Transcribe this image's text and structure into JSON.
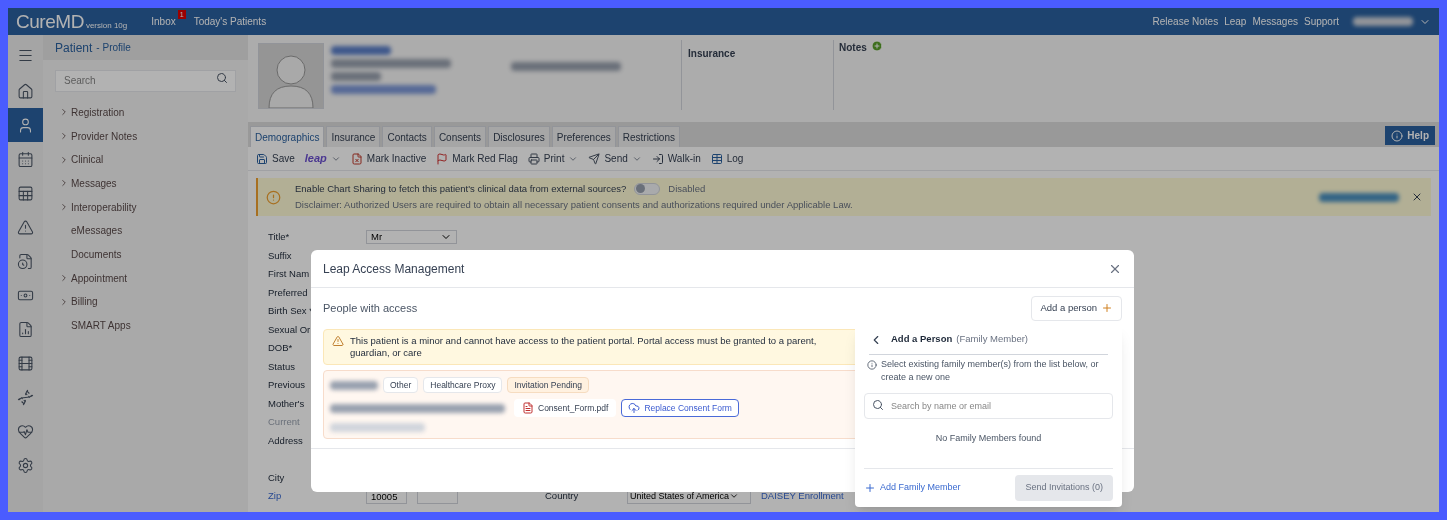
{
  "header": {
    "logo": "CureMD",
    "version": "version 10g",
    "links": [
      {
        "label": "Inbox",
        "badge": "1"
      },
      {
        "label": "Today's Patients"
      }
    ],
    "right_links": [
      "Release Notes",
      "Leap",
      "Messages",
      "Support"
    ]
  },
  "rail": [
    {
      "selected": false
    },
    {
      "selected": false
    },
    {
      "selected": true
    },
    {
      "selected": false
    },
    {
      "selected": false
    },
    {
      "selected": false
    },
    {
      "selected": false
    },
    {
      "selected": false
    },
    {
      "selected": false
    },
    {
      "selected": false
    },
    {
      "selected": false
    },
    {
      "selected": false
    },
    {
      "selected": false
    }
  ],
  "nav": {
    "title": "Patient",
    "subtitle": "- Profile",
    "search_placeholder": "Search",
    "items": [
      {
        "label": "Registration",
        "expandable": true
      },
      {
        "label": "Provider Notes",
        "expandable": true
      },
      {
        "label": "Clinical",
        "expandable": true
      },
      {
        "label": "Messages",
        "expandable": true
      },
      {
        "label": "Interoperability",
        "expandable": true
      },
      {
        "label": "eMessages",
        "expandable": false
      },
      {
        "label": "Documents",
        "expandable": false
      },
      {
        "label": "Appointment",
        "expandable": true
      },
      {
        "label": "Billing",
        "expandable": true
      },
      {
        "label": "SMART Apps",
        "expandable": false
      }
    ]
  },
  "patient": {
    "insurance_label": "Insurance",
    "notes_label": "Notes"
  },
  "tabs": [
    {
      "label": "Demographics",
      "selected": true
    },
    {
      "label": "Insurance",
      "selected": false
    },
    {
      "label": "Contacts",
      "selected": false
    },
    {
      "label": "Consents",
      "selected": false
    },
    {
      "label": "Disclosures",
      "selected": false
    },
    {
      "label": "Preferences",
      "selected": false
    },
    {
      "label": "Restrictions",
      "selected": false
    }
  ],
  "help": "Help",
  "toolbar": [
    {
      "kind": "action",
      "label": "Save",
      "dropdown": false
    },
    {
      "kind": "logo",
      "label": "leap",
      "dropdown": true
    },
    {
      "kind": "action",
      "label": "Mark Inactive",
      "dropdown": false
    },
    {
      "kind": "action",
      "label": "Mark Red Flag",
      "dropdown": false
    },
    {
      "kind": "action",
      "label": "Print",
      "dropdown": true
    },
    {
      "kind": "action",
      "label": "Send",
      "dropdown": true
    },
    {
      "kind": "action",
      "label": "Walk-in",
      "dropdown": false
    },
    {
      "kind": "action",
      "label": "Log",
      "dropdown": false
    }
  ],
  "chart_sharing": {
    "message": "Enable Chart Sharing to fetch this patient's clinical data from external sources?",
    "on": false,
    "toggle_label": "Disabled",
    "disclaimer": "Disclaimer: Authorized Users are required to obtain all necessary patient consents and authorizations required under Applicable Law."
  },
  "form": [
    {
      "label": "Title*",
      "kind": "select",
      "value": "Mr"
    },
    {
      "label": "Suffix",
      "kind": "plain"
    },
    {
      "label": "First Nam",
      "kind": "plain"
    },
    {
      "label": "Preferred",
      "kind": "plain"
    },
    {
      "label": "Birth Sex *",
      "kind": "plain"
    },
    {
      "label": "Sexual Or",
      "kind": "plain"
    },
    {
      "label": "DOB*",
      "kind": "plain"
    },
    {
      "label": "Status",
      "kind": "plain"
    },
    {
      "label": "Previous",
      "kind": "plain"
    },
    {
      "label": "Mother's",
      "kind": "plain"
    },
    {
      "label": "Current",
      "kind": "muted"
    },
    {
      "label": "Address",
      "kind": "plain"
    }
  ],
  "address": [
    {
      "label": "City",
      "kind": "plain"
    },
    {
      "label": "Zip",
      "kind": "link",
      "value": "10005",
      "country_label": "Country",
      "country": "United States of America",
      "link": "DAISEY Enrollment"
    }
  ],
  "modal": {
    "title": "Leap Access Management",
    "section": "People with access",
    "add_button": "Add a person",
    "warning": "This patient is a minor and cannot have access to the patient portal. Portal access must be granted to a parent, guardian, or care",
    "person": {
      "tags": [
        {
          "label": "Other",
          "kind": "role"
        },
        {
          "label": "Healthcare Proxy",
          "kind": "role"
        },
        {
          "label": "Invitation Pending",
          "kind": "status"
        }
      ],
      "file": "Consent_Form.pdf",
      "replace_button": "Replace Consent Form"
    }
  },
  "popover": {
    "title": "Add a Person",
    "subtitle": "(Family Member)",
    "info": "Select existing family member(s) from the list below, or create a new one",
    "search_placeholder": "Search by name or email",
    "empty": "No Family Members found",
    "add_link": "Add Family Member",
    "send_button": "Send Invitations (0)",
    "send_disabled": true
  }
}
